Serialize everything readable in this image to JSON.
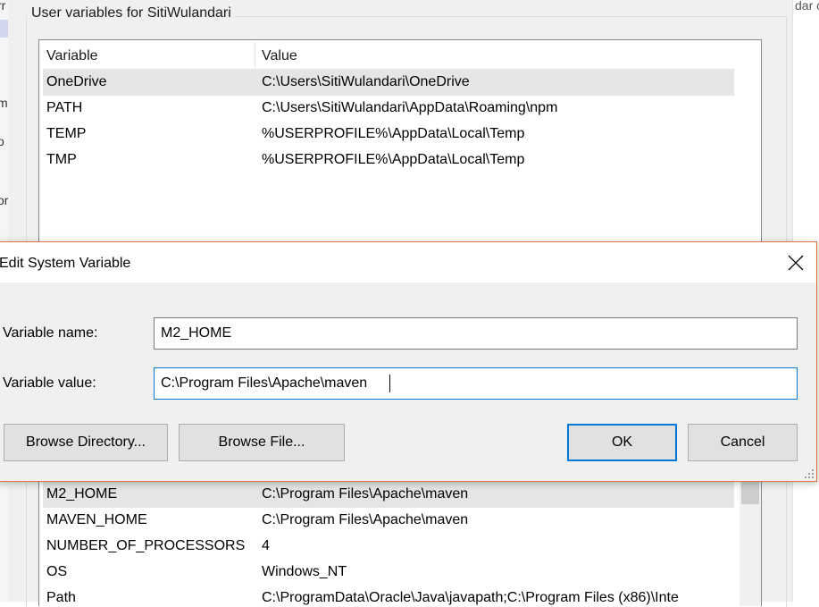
{
  "background": {
    "left_fragments": [
      "rr",
      "m",
      "o",
      "or"
    ],
    "right_fragment": "dar c"
  },
  "user_variables": {
    "group_label": "User variables for SitiWulandari",
    "columns": {
      "variable": "Variable",
      "value": "Value"
    },
    "rows": [
      {
        "variable": "OneDrive",
        "value": "C:\\Users\\SitiWulandari\\OneDrive"
      },
      {
        "variable": "PATH",
        "value": "C:\\Users\\SitiWulandari\\AppData\\Roaming\\npm"
      },
      {
        "variable": "TEMP",
        "value": "%USERPROFILE%\\AppData\\Local\\Temp"
      },
      {
        "variable": "TMP",
        "value": "%USERPROFILE%\\AppData\\Local\\Temp"
      }
    ]
  },
  "system_variables": {
    "rows": [
      {
        "variable": "M2_HOME",
        "value": "C:\\Program Files\\Apache\\maven"
      },
      {
        "variable": "MAVEN_HOME",
        "value": "C:\\Program Files\\Apache\\maven"
      },
      {
        "variable": "NUMBER_OF_PROCESSORS",
        "value": "4"
      },
      {
        "variable": "OS",
        "value": "Windows_NT"
      },
      {
        "variable": "Path",
        "value": "C:\\ProgramData\\Oracle\\Java\\javapath;C:\\Program Files (x86)\\Inte"
      }
    ]
  },
  "dialog": {
    "title": "Edit System Variable",
    "name_label": "Variable name:",
    "name_value": "M2_HOME",
    "value_label": "Variable value:",
    "value_value": "C:\\Program Files\\Apache\\maven",
    "browse_directory": "Browse Directory...",
    "browse_file": "Browse File...",
    "ok": "OK",
    "cancel": "Cancel",
    "close_icon": "close-icon",
    "accent_color": "#0078d7",
    "border_color": "#e0743f"
  }
}
